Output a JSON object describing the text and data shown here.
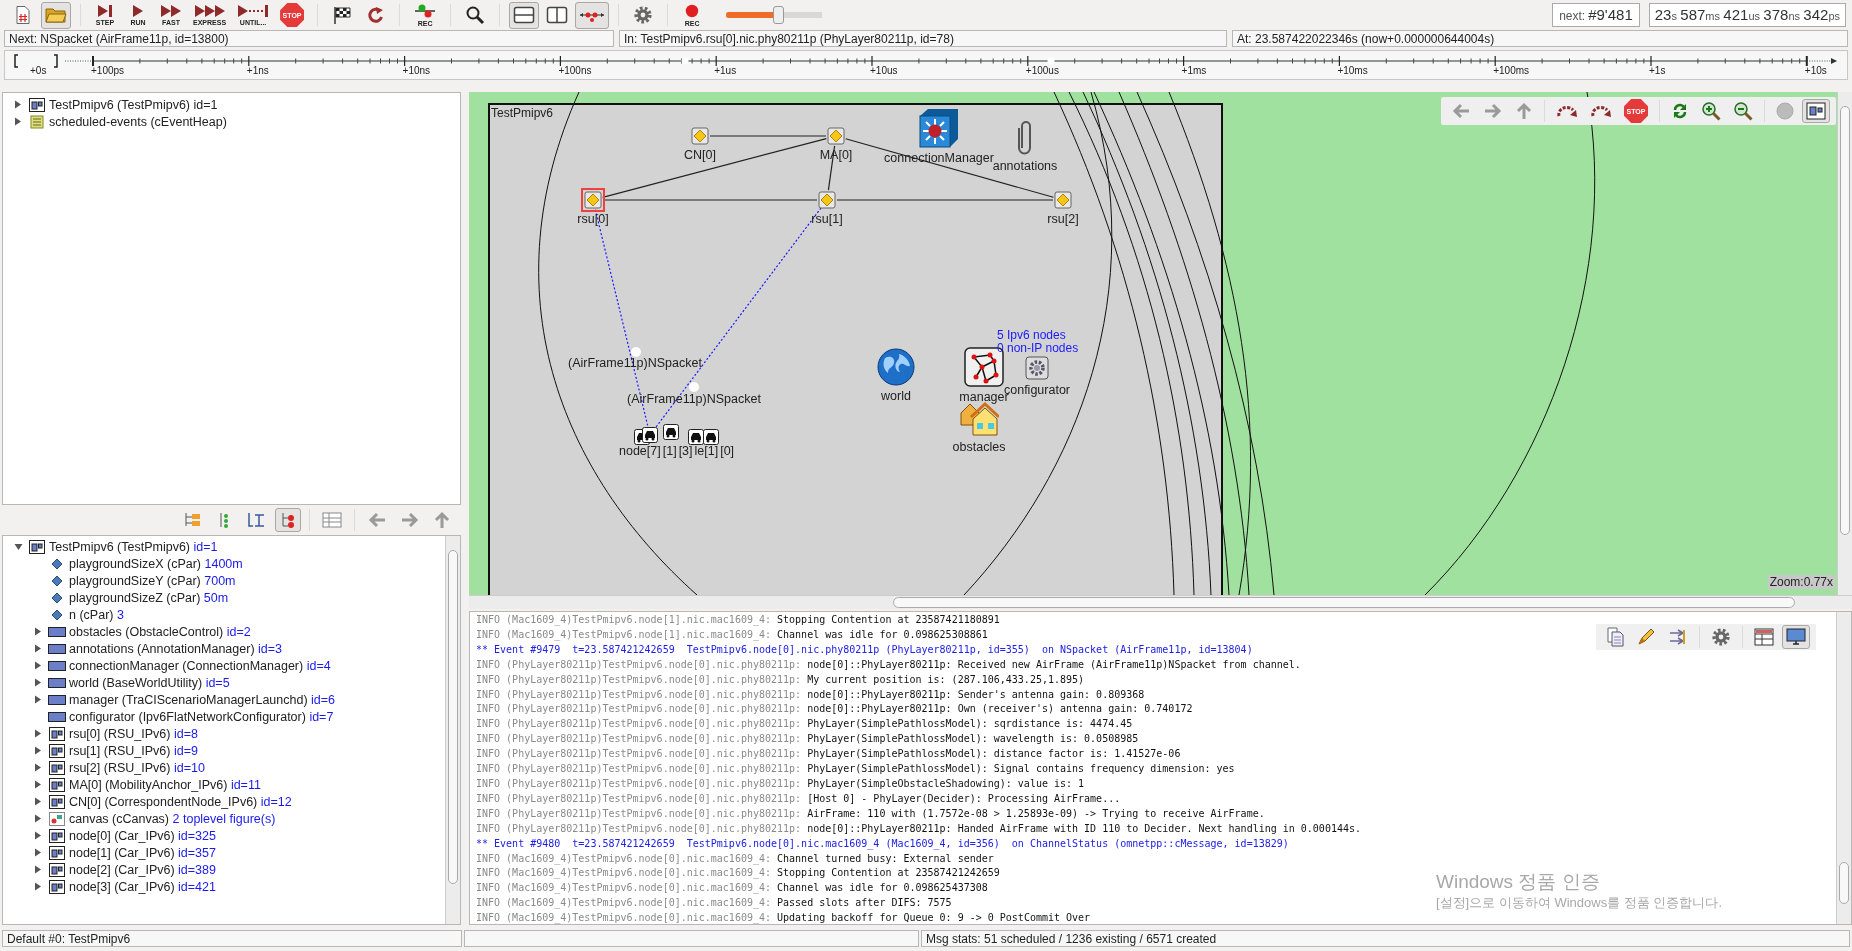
{
  "toolbar": {
    "buttons": [
      {
        "kind": "new",
        "pressed": false
      },
      {
        "kind": "open",
        "pressed": true
      },
      {
        "kind": "step",
        "caption": "STEP",
        "pressed": false
      },
      {
        "kind": "run",
        "caption": "RUN",
        "pressed": false
      },
      {
        "kind": "fast",
        "caption": "FAST",
        "pressed": false
      },
      {
        "kind": "express",
        "caption": "EXPRESS",
        "pressed": false
      },
      {
        "kind": "until",
        "caption": "UNTIL...",
        "pressed": false
      },
      {
        "kind": "stop",
        "caption": "STOP",
        "pressed": false
      },
      {
        "kind": "finish",
        "pressed": false
      },
      {
        "kind": "rebuild",
        "pressed": false
      },
      {
        "kind": "eventlog",
        "caption": "REC",
        "pressed": false
      },
      {
        "kind": "find",
        "pressed": false
      },
      {
        "kind": "split-h",
        "pressed": true
      },
      {
        "kind": "split-v",
        "pressed": false
      },
      {
        "kind": "timeline",
        "pressed": true
      },
      {
        "kind": "settings",
        "pressed": false
      },
      {
        "kind": "record",
        "caption": "REC",
        "pressed": false
      }
    ],
    "speed": {
      "level": 0.55
    },
    "next_event": {
      "label": "next:",
      "value": "#9'481"
    },
    "sim_time": [
      {
        "value": "23",
        "unit": "s"
      },
      {
        "value": "587",
        "unit": "ms"
      },
      {
        "value": "421",
        "unit": "us"
      },
      {
        "value": "378",
        "unit": "ns"
      },
      {
        "value": "342",
        "unit": "ps"
      }
    ]
  },
  "info_bar": [
    "Next: NSpacket (AirFrame11p, id=13800)",
    "In: TestPmipv6.rsu[0].nic.phy80211p (PhyLayer80211p, id=78)",
    "At: 23.587422022346s (now+0.000000644004s)"
  ],
  "timeline": {
    "ticks": [
      "+0s",
      "+100ps",
      "+1ns",
      "+10ns",
      "+100ns",
      "+1us",
      "+10us",
      "+100us",
      "+1ms",
      "+10ms",
      "+100ms",
      "+1s",
      "+10s"
    ]
  },
  "object_tree": [
    {
      "kind": "compound",
      "label": "TestPmipv6 (TestPmipv6) id=1",
      "expanded": false
    },
    {
      "kind": "heap",
      "label": "scheduled-events (cEventHeap)",
      "expanded": false
    }
  ],
  "tree_toolbar": [
    {
      "kind": "tree-a",
      "pressed": false
    },
    {
      "kind": "tree-b",
      "pressed": false
    },
    {
      "kind": "tree-c",
      "pressed": false
    },
    {
      "kind": "tree-d",
      "pressed": true
    },
    {
      "kind": "table",
      "pressed": false
    },
    {
      "kind": "back",
      "pressed": false
    },
    {
      "kind": "forward",
      "pressed": false
    },
    {
      "kind": "up",
      "pressed": false
    }
  ],
  "module_tree": [
    {
      "kind": "compound",
      "label": "TestPmipv6 (TestPmipv6)",
      "detail": "id=1",
      "expanded": true,
      "children": [
        {
          "kind": "param",
          "label": "playgroundSizeX (cPar)",
          "detail": "1400m"
        },
        {
          "kind": "param",
          "label": "playgroundSizeY (cPar)",
          "detail": "700m"
        },
        {
          "kind": "param",
          "label": "playgroundSizeZ (cPar)",
          "detail": "50m"
        },
        {
          "kind": "param",
          "label": "n (cPar)",
          "detail": "3"
        },
        {
          "kind": "simple",
          "label": "obstacles (ObstacleControl)",
          "detail": "id=2",
          "expanded": false
        },
        {
          "kind": "simple",
          "label": "annotations (AnnotationManager)",
          "detail": "id=3",
          "expanded": false
        },
        {
          "kind": "simple",
          "label": "connectionManager (ConnectionManager)",
          "detail": "id=4",
          "expanded": false
        },
        {
          "kind": "simple",
          "label": "world (BaseWorldUtility)",
          "detail": "id=5",
          "expanded": false
        },
        {
          "kind": "simple",
          "label": "manager (TraCIScenarioManagerLaunchd)",
          "detail": "id=6",
          "expanded": false
        },
        {
          "kind": "simple",
          "label": "configurator (Ipv6FlatNetworkConfigurator)",
          "detail": "id=7"
        },
        {
          "kind": "compound",
          "label": "rsu[0] (RSU_IPv6)",
          "detail": "id=8",
          "expanded": false
        },
        {
          "kind": "compound",
          "label": "rsu[1] (RSU_IPv6)",
          "detail": "id=9",
          "expanded": false
        },
        {
          "kind": "compound",
          "label": "rsu[2] (RSU_IPv6)",
          "detail": "id=10",
          "expanded": false
        },
        {
          "kind": "compound",
          "label": "MA[0] (MobilityAnchor_IPv6)",
          "detail": "id=11",
          "expanded": false
        },
        {
          "kind": "compound",
          "label": "CN[0] (CorrespondentNode_IPv6)",
          "detail": "id=12",
          "expanded": false
        },
        {
          "kind": "canvas",
          "label": "canvas (cCanvas)",
          "detail": "2 toplevel figure(s)",
          "expanded": false
        },
        {
          "kind": "compound",
          "label": "node[0] (Car_IPv6)",
          "detail": "id=325",
          "expanded": false
        },
        {
          "kind": "compound",
          "label": "node[1] (Car_IPv6)",
          "detail": "id=357",
          "expanded": false
        },
        {
          "kind": "compound",
          "label": "node[2] (Car_IPv6)",
          "detail": "id=389",
          "expanded": false
        },
        {
          "kind": "compound",
          "label": "node[3] (Car_IPv6)",
          "detail": "id=421",
          "expanded": false
        }
      ]
    }
  ],
  "network": {
    "title": "TestPmipv6",
    "modules": [
      {
        "kind": "host",
        "label": "CN[0]",
        "selected": false
      },
      {
        "kind": "host",
        "label": "MA[0]",
        "selected": false
      },
      {
        "kind": "switch",
        "label": "connectionManager",
        "selected": false
      },
      {
        "kind": "clip",
        "label": "annotations",
        "selected": false
      },
      {
        "kind": "host",
        "label": "rsu[0]",
        "selected": true
      },
      {
        "kind": "host",
        "label": "rsu[1]",
        "selected": false
      },
      {
        "kind": "host",
        "label": "rsu[2]",
        "selected": false
      },
      {
        "kind": "globe",
        "label": "world",
        "selected": false
      },
      {
        "kind": "graph",
        "label": "manager",
        "selected": false
      },
      {
        "kind": "cog",
        "label": "configurator",
        "selected": false,
        "status": [
          "5 Ipv6 nodes",
          "0 non-IP nodes"
        ]
      },
      {
        "kind": "houses",
        "label": "obstacles",
        "selected": false
      },
      {
        "kind": "car",
        "label": "node[7]",
        "selected": false
      },
      {
        "kind": "car",
        "label": "[1]",
        "selected": false
      },
      {
        "kind": "car",
        "label": "[3]",
        "selected": false
      },
      {
        "kind": "car",
        "label": "le[1]",
        "selected": false
      },
      {
        "kind": "car",
        "label": "[0]",
        "selected": false
      }
    ],
    "messages": [
      {
        "label": "(AirFrame11p)NSpacket"
      },
      {
        "label": "(AirFrame11p)NSpacket"
      }
    ],
    "zoom": "Zoom:0.77x"
  },
  "canvas_toolbar": [
    {
      "kind": "back",
      "pressed": false
    },
    {
      "kind": "forward",
      "pressed": false
    },
    {
      "kind": "up",
      "pressed": false
    },
    {
      "kind": "local-step",
      "pressed": false
    },
    {
      "kind": "local-run",
      "pressed": false
    },
    {
      "kind": "stop",
      "caption": "STOP",
      "pressed": false
    },
    {
      "kind": "relayout",
      "pressed": false
    },
    {
      "kind": "zoom-in",
      "pressed": false
    },
    {
      "kind": "zoom-out",
      "pressed": false
    },
    {
      "kind": "animation",
      "pressed": false
    },
    {
      "kind": "module-view",
      "pressed": true
    }
  ],
  "log_toolbar": [
    {
      "kind": "copy",
      "pressed": false
    },
    {
      "kind": "highlight",
      "pressed": false
    },
    {
      "kind": "filter",
      "pressed": false
    },
    {
      "kind": "settings",
      "pressed": false
    },
    {
      "kind": "messages",
      "pressed": false
    },
    {
      "kind": "log",
      "pressed": true
    }
  ],
  "log": [
    {
      "kind": "info",
      "prefix": "INFO (Mac1609_4)TestPmipv6.node[1].nic.mac1609_4:",
      "text": "Stopping Contention at 23587421180891"
    },
    {
      "kind": "info",
      "prefix": "INFO (Mac1609_4)TestPmipv6.node[1].nic.mac1609_4:",
      "text": "Channel was idle for 0.098625308861"
    },
    {
      "kind": "event",
      "text": "** Event #9479  t=23.587421242659  TestPmipv6.node[0].nic.phy80211p (PhyLayer80211p, id=355)  on NSpacket (AirFrame11p, id=13804)"
    },
    {
      "kind": "info",
      "prefix": "INFO (PhyLayer80211p)TestPmipv6.node[0].nic.phy80211p:",
      "text": "node[0]::PhyLayer80211p: Received new AirFrame (AirFrame11p)NSpacket from channel."
    },
    {
      "kind": "info",
      "prefix": "INFO (PhyLayer80211p)TestPmipv6.node[0].nic.phy80211p:",
      "text": "My current position is: (287.106,433.25,1.895)"
    },
    {
      "kind": "info",
      "prefix": "INFO (PhyLayer80211p)TestPmipv6.node[0].nic.phy80211p:",
      "text": "node[0]::PhyLayer80211p: Sender's antenna gain: 0.809368"
    },
    {
      "kind": "info",
      "prefix": "INFO (PhyLayer80211p)TestPmipv6.node[0].nic.phy80211p:",
      "text": "node[0]::PhyLayer80211p: Own (receiver's) antenna gain: 0.740172"
    },
    {
      "kind": "info",
      "prefix": "INFO (PhyLayer80211p)TestPmipv6.node[0].nic.phy80211p:",
      "text": "PhyLayer(SimplePathlossModel): sqrdistance is: 4474.45"
    },
    {
      "kind": "info",
      "prefix": "INFO (PhyLayer80211p)TestPmipv6.node[0].nic.phy80211p:",
      "text": "PhyLayer(SimplePathlossModel): wavelength is: 0.0508985"
    },
    {
      "kind": "info",
      "prefix": "INFO (PhyLayer80211p)TestPmipv6.node[0].nic.phy80211p:",
      "text": "PhyLayer(SimplePathlossModel): distance factor is: 1.41527e-06"
    },
    {
      "kind": "info",
      "prefix": "INFO (PhyLayer80211p)TestPmipv6.node[0].nic.phy80211p:",
      "text": "PhyLayer(SimplePathlossModel): Signal contains frequency dimension: yes"
    },
    {
      "kind": "info",
      "prefix": "INFO (PhyLayer80211p)TestPmipv6.node[0].nic.phy80211p:",
      "text": "PhyLayer(SimpleObstacleShadowing): value is: 1"
    },
    {
      "kind": "info",
      "prefix": "INFO (PhyLayer80211p)TestPmipv6.node[0].nic.phy80211p:",
      "text": "[Host 0] - PhyLayer(Decider): Processing AirFrame..."
    },
    {
      "kind": "info",
      "prefix": "INFO (PhyLayer80211p)TestPmipv6.node[0].nic.phy80211p:",
      "text": "AirFrame: 110 with (1.7572e-08 > 1.25893e-09) -> Trying to receive AirFrame."
    },
    {
      "kind": "info",
      "prefix": "INFO (PhyLayer80211p)TestPmipv6.node[0].nic.phy80211p:",
      "text": "node[0]::PhyLayer80211p: Handed AirFrame with ID 110 to Decider. Next handling in 0.000144s."
    },
    {
      "kind": "event",
      "text": "** Event #9480  t=23.587421242659  TestPmipv6.node[0].nic.mac1609_4 (Mac1609_4, id=356)  on ChannelStatus (omnetpp::cMessage, id=13829)"
    },
    {
      "kind": "info",
      "prefix": "INFO (Mac1609_4)TestPmipv6.node[0].nic.mac1609_4:",
      "text": "Channel turned busy: External sender"
    },
    {
      "kind": "info",
      "prefix": "INFO (Mac1609_4)TestPmipv6.node[0].nic.mac1609_4:",
      "text": "Stopping Contention at 23587421242659"
    },
    {
      "kind": "info",
      "prefix": "INFO (Mac1609_4)TestPmipv6.node[0].nic.mac1609_4:",
      "text": "Channel was idle for 0.098625437308"
    },
    {
      "kind": "info",
      "prefix": "INFO (Mac1609_4)TestPmipv6.node[0].nic.mac1609_4:",
      "text": "Passed slots after DIFS: 7575"
    },
    {
      "kind": "info",
      "prefix": "INFO (Mac1609_4)TestPmipv6.node[0].nic.mac1609_4:",
      "text": "Updating backoff for Queue 0: 9 -> 0 PostCommit Over"
    }
  ],
  "activation_notice": {
    "title": "Windows 정품 인증",
    "text": "[설정]으로 이동하여 Windows를 정품 인증합니다."
  },
  "status_bar": {
    "left": "Default #0: TestPmipv6",
    "right": "Msg stats: 51 scheduled / 1236 existing / 6571 created"
  }
}
